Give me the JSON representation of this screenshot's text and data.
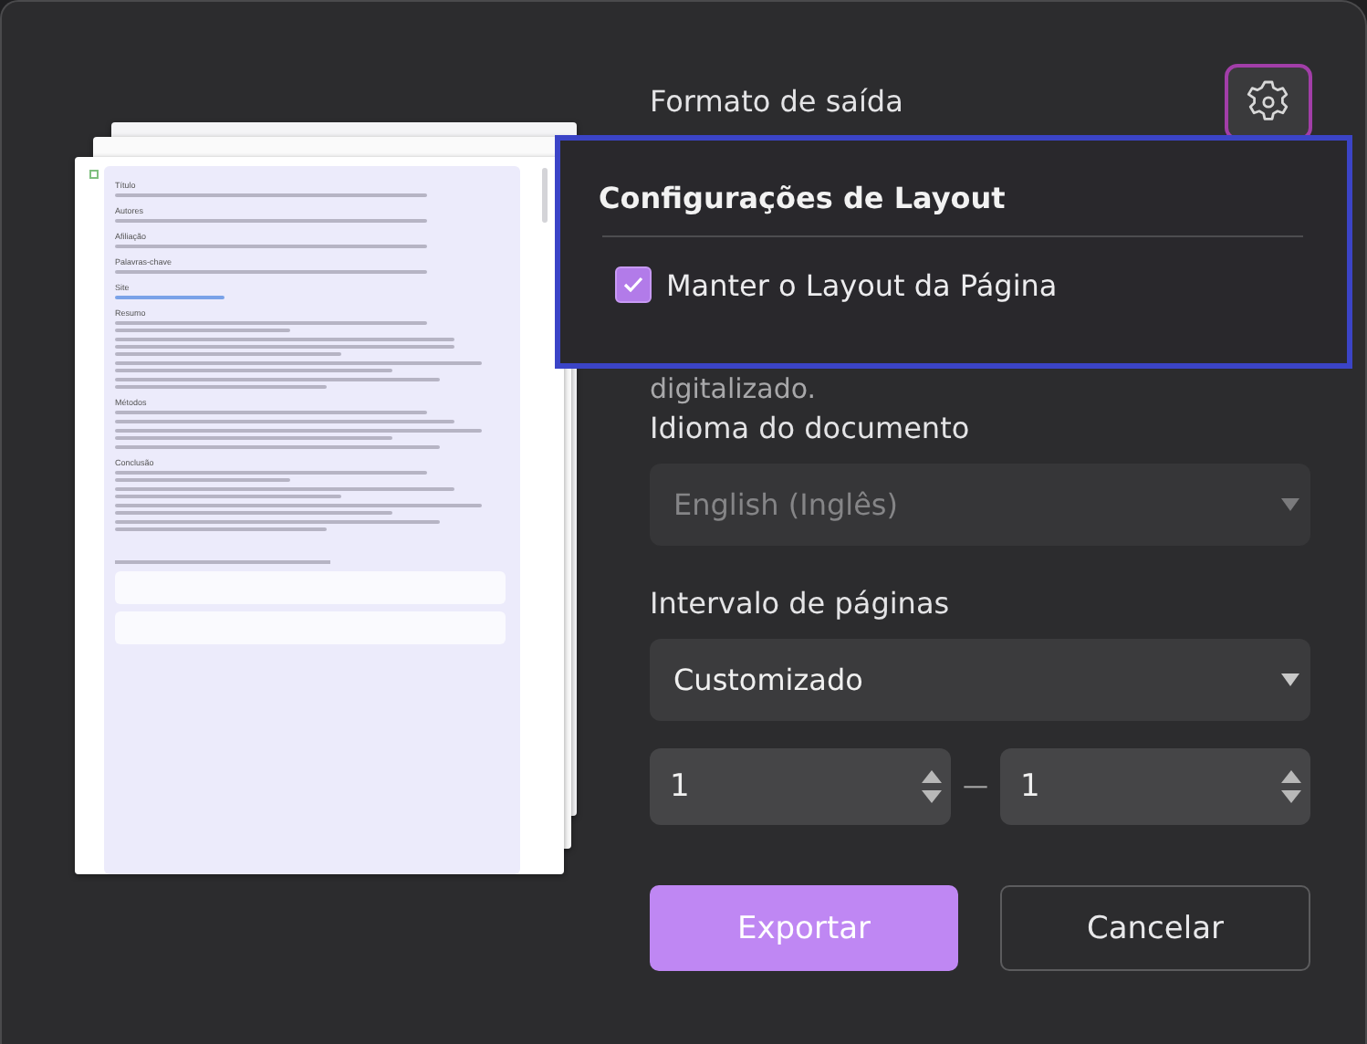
{
  "preview": {
    "headings": [
      "Título",
      "Autores",
      "Afiliação",
      "Palavras-chave",
      "Site",
      "Resumo",
      "Métodos",
      "Conclusão"
    ]
  },
  "output_format": {
    "label": "Formato de saída"
  },
  "layout_popup": {
    "title": "Configurações de Layout",
    "options": [
      {
        "label": "Manter o Layout da Página",
        "checked": true
      }
    ]
  },
  "hidden_note": "digitalizado.",
  "language": {
    "label": "Idioma do documento",
    "value": "English (Inglês)",
    "disabled": true
  },
  "page_range": {
    "label": "Intervalo de páginas",
    "value": "Customizado",
    "from": "1",
    "separator": "—",
    "to": "1"
  },
  "buttons": [
    {
      "label": "Exportar",
      "kind": "primary"
    },
    {
      "label": "Cancelar",
      "kind": "secondary"
    }
  ]
}
